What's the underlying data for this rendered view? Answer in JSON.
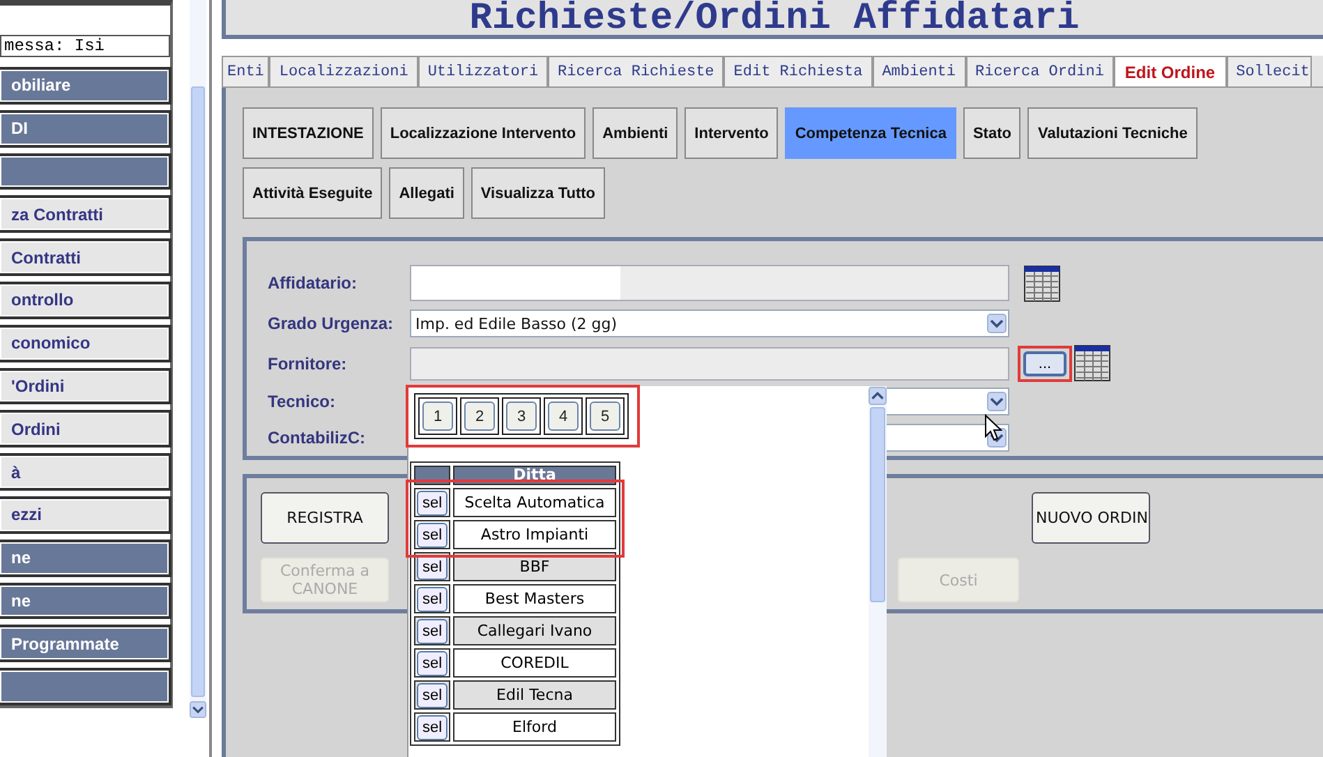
{
  "sidebar": {
    "status_field": "messa: Isi",
    "items": [
      {
        "label": "obiliare",
        "kind": "dark"
      },
      {
        "label": "DI",
        "kind": "dark"
      },
      {
        "kind": "dark"
      },
      {
        "label": "za Contratti",
        "kind": "light"
      },
      {
        "label": "Contratti",
        "kind": "light"
      },
      {
        "label": "ontrollo",
        "kind": "light"
      },
      {
        "label": "conomico",
        "kind": "light"
      },
      {
        "label": "'Ordini",
        "kind": "light"
      },
      {
        "label": "Ordini",
        "kind": "light"
      },
      {
        "label": "à",
        "kind": "light"
      },
      {
        "label": "ezzi",
        "kind": "light"
      },
      {
        "label": "ne",
        "kind": "dark"
      },
      {
        "label": "ne",
        "kind": "dark"
      },
      {
        "label": "Programmate",
        "kind": "dark"
      },
      {
        "kind": "dark"
      }
    ]
  },
  "title": "Richieste/Ordini Affidatari",
  "tabs": [
    {
      "label": "Enti",
      "selected": false
    },
    {
      "label": "Localizzazioni",
      "selected": false
    },
    {
      "label": "Utilizzatori",
      "selected": false
    },
    {
      "label": "Ricerca Richieste",
      "selected": false
    },
    {
      "label": "Edit Richiesta",
      "selected": false
    },
    {
      "label": "Ambienti",
      "selected": false
    },
    {
      "label": "Ricerca Ordini",
      "selected": false
    },
    {
      "label": "Edit Ordine",
      "selected": true
    },
    {
      "label": "Sollecit",
      "selected": false
    }
  ],
  "section_rows": [
    {
      "buttons": [
        {
          "label": "INTESTAZIONE",
          "selected": false
        },
        {
          "label": "Localizzazione Intervento",
          "selected": false
        },
        {
          "label": "Ambienti",
          "selected": false
        },
        {
          "label": "Intervento",
          "selected": false
        },
        {
          "label": "Competenza Tecnica",
          "selected": true
        },
        {
          "label": "Stato",
          "selected": false
        },
        {
          "label": "Valutazioni Tecniche",
          "selected": false
        }
      ]
    },
    {
      "buttons": [
        {
          "label": "Attività Eseguite",
          "selected": false
        },
        {
          "label": "Allegati",
          "selected": false
        },
        {
          "label": "Visualizza Tutto",
          "selected": false
        }
      ]
    }
  ],
  "form": {
    "fields": [
      {
        "label": "Affidatario:",
        "kind": "picker"
      },
      {
        "label": "Grado Urgenza:",
        "kind": "select",
        "value": "Imp. ed Edile Basso (2 gg)"
      },
      {
        "label": "Fornitore:",
        "kind": "lookup",
        "button": "...",
        "highlighted": true
      },
      {
        "label": "Tecnico:",
        "kind": "select"
      },
      {
        "label": "ContabilizC:",
        "kind": "select"
      }
    ]
  },
  "actions": [
    {
      "label": "REGISTRA",
      "disabled": false
    },
    {
      "label": "Conferma a CANONE",
      "disabled": true
    },
    {
      "label": "Costi",
      "disabled": true
    },
    {
      "label": "NUOVO ORDIN",
      "disabled": false
    }
  ],
  "popup": {
    "pagination": {
      "highlighted": true,
      "pages": [
        {
          "label": "1"
        },
        {
          "label": "2"
        },
        {
          "label": "3"
        },
        {
          "label": "4"
        },
        {
          "label": "5"
        }
      ]
    },
    "column": "Ditta",
    "rows": [
      {
        "button": "sel",
        "name": "Scelta Automatica",
        "shaded": false,
        "highlighted": true
      },
      {
        "button": "sel",
        "name": "Astro Impianti",
        "shaded": false,
        "highlighted": true
      },
      {
        "button": "sel",
        "name": "BBF",
        "shaded": true,
        "highlighted": false
      },
      {
        "button": "sel",
        "name": "Best Masters",
        "shaded": false,
        "highlighted": false
      },
      {
        "button": "sel",
        "name": "Callegari Ivano",
        "shaded": true,
        "highlighted": false
      },
      {
        "button": "sel",
        "name": "COREDIL",
        "shaded": false,
        "highlighted": false
      },
      {
        "button": "sel",
        "name": "Edil Tecna",
        "shaded": true,
        "highlighted": false
      },
      {
        "button": "sel",
        "name": "Elford",
        "shaded": false,
        "highlighted": false
      }
    ]
  }
}
